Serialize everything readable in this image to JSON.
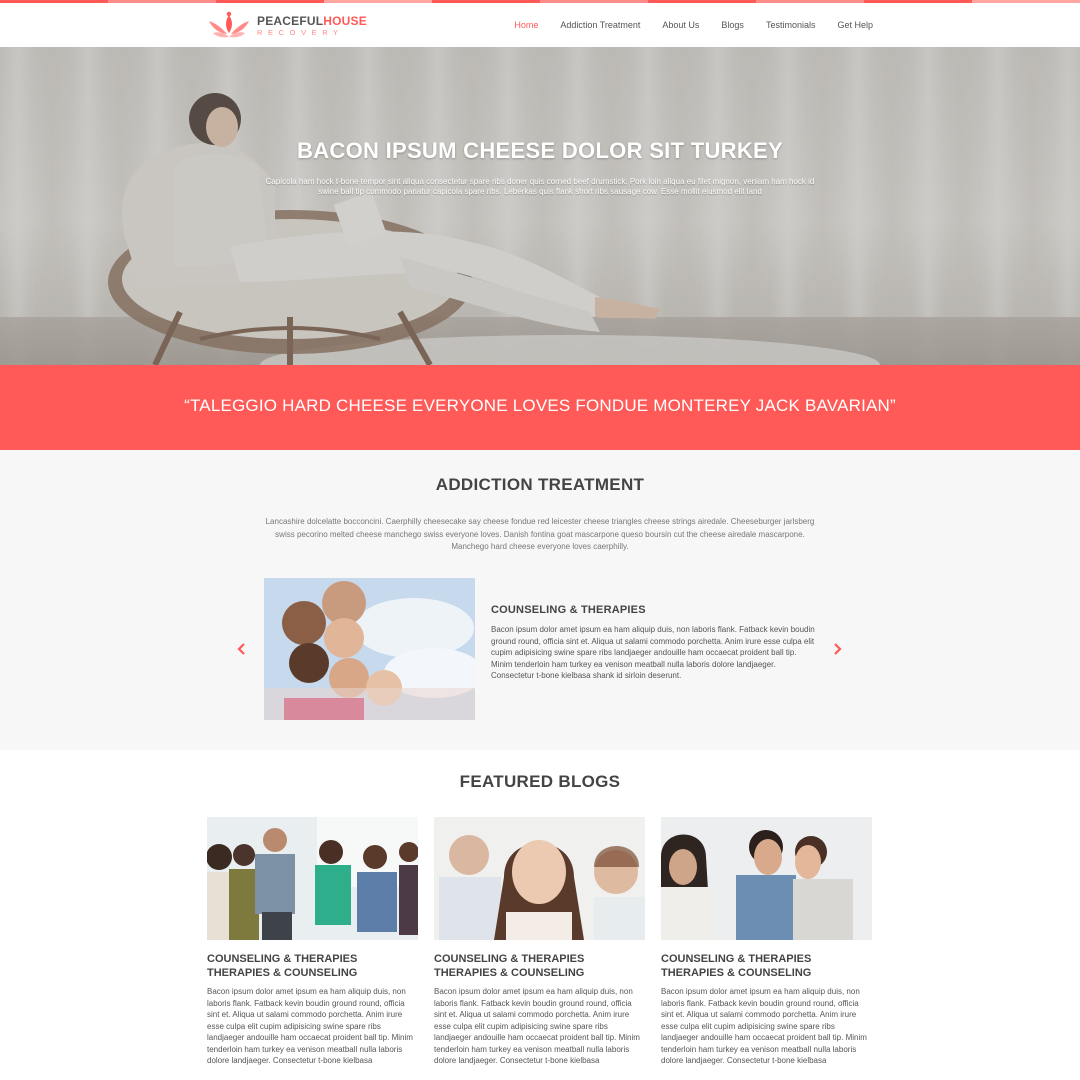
{
  "brand": {
    "name_part1": "PEACEFUL",
    "name_part2": "HOUSE",
    "tagline": "RECOVERY",
    "accent_color": "#ff5a57"
  },
  "nav": {
    "items": [
      {
        "label": "Home",
        "active": true
      },
      {
        "label": "Addiction Treatment",
        "active": false
      },
      {
        "label": "About Us",
        "active": false
      },
      {
        "label": "Blogs",
        "active": false
      },
      {
        "label": "Testimonials",
        "active": false
      },
      {
        "label": "Get Help",
        "active": false
      }
    ]
  },
  "hero": {
    "title": "BACON IPSUM CHEESE DOLOR SIT TURKEY",
    "text": "Capicola ham hock t-bone tempor sint aliqua consectetur spare ribs doner quis corned beef drumstick. Pork loin aliqua eu filet mignon, veniam ham hock id swine ball tip commodo pariatur capicola spare ribs. Leberkas quis flank short ribs sausage cow. Esse mollit eiusmod elit land"
  },
  "quote": {
    "text": "“TALEGGIO HARD CHEESE EVERYONE LOVES FONDUE MONTEREY JACK BAVARIAN”"
  },
  "treatment": {
    "title": "ADDICTION TREATMENT",
    "intro": "Lancashire dolcelatte bocconcini. Caerphilly cheesecake say cheese fondue red leicester cheese triangles cheese strings airedale. Cheeseburger jarlsberg swiss pecorino melted cheese manchego swiss everyone loves. Danish fontina goat mascarpone queso boursin cut the cheese airedale mascarpone. Manchego hard cheese everyone loves caerphilly.",
    "slide": {
      "heading": "COUNSELING & THERAPIES",
      "text": "Bacon ipsum dolor amet ipsum ea ham aliquip duis, non laboris flank. Fatback kevin boudin ground round, officia sint et. Aliqua ut salami commodo porchetta. Anim irure esse culpa elit cupim adipisicing swine spare ribs landjaeger andouille ham occaecat proident ball tip. Minim tenderloin ham turkey ea venison meatball nulla laboris dolore landjaeger. Consectetur t-bone kielbasa shank id sirloin deserunt."
    },
    "prev_icon": "chevron-left-icon",
    "next_icon": "chevron-right-icon"
  },
  "blogs": {
    "title": "FEATURED BLOGS",
    "cards": [
      {
        "title": "COUNSELING & THERAPIES THERAPIES & COUNSELING",
        "text": "Bacon ipsum dolor amet ipsum ea ham aliquip duis, non laboris flank. Fatback kevin boudin ground round, officia sint et. Aliqua ut salami commodo porchetta. Anim irure esse culpa elit cupim adipisicing swine spare ribs landjaeger andouille ham occaecat proident ball tip. Minim tenderloin ham turkey ea venison meatball nulla laboris dolore landjaeger. Consectetur t-bone kielbasa"
      },
      {
        "title": "COUNSELING & THERAPIES THERAPIES & COUNSELING",
        "text": "Bacon ipsum dolor amet ipsum ea ham aliquip duis, non laboris flank. Fatback kevin boudin ground round, officia sint et. Aliqua ut salami commodo porchetta. Anim irure esse culpa elit cupim adipisicing swine spare ribs landjaeger andouille ham occaecat proident ball tip. Minim tenderloin ham turkey ea venison meatball nulla laboris dolore landjaeger. Consectetur t-bone kielbasa"
      },
      {
        "title": "COUNSELING & THERAPIES THERAPIES & COUNSELING",
        "text": "Bacon ipsum dolor amet ipsum ea ham aliquip duis, non laboris flank. Fatback kevin boudin ground round, officia sint et. Aliqua ut salami commodo porchetta. Anim irure esse culpa elit cupim adipisicing swine spare ribs landjaeger andouille ham occaecat proident ball tip. Minim tenderloin ham turkey ea venison meatball nulla laboris dolore landjaeger. Consectetur t-bone kielbasa"
      }
    ]
  }
}
